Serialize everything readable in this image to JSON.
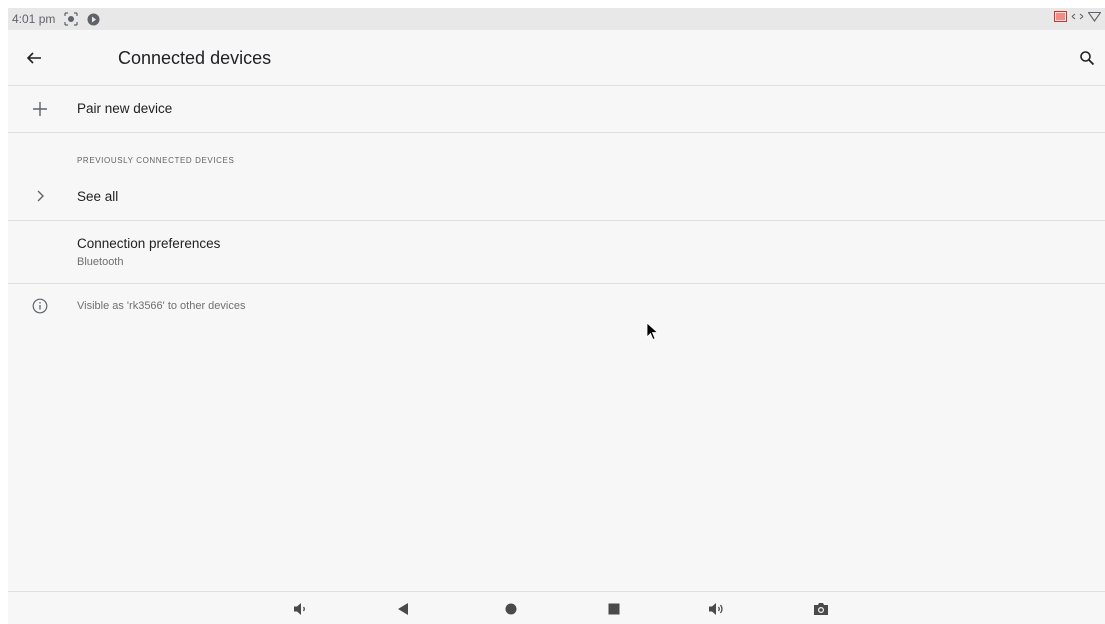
{
  "status_bar": {
    "time": "4:01 pm",
    "left_icons": [
      "screen-record-icon",
      "play-store-notification-icon"
    ],
    "right_icons": [
      "cast-icon",
      "data-transfer-icon",
      "wifi-icon"
    ]
  },
  "app_bar": {
    "title": "Connected devices",
    "back_icon": "arrow-left-icon",
    "search_icon": "search-icon"
  },
  "list": {
    "pair_new_device": {
      "label": "Pair new device",
      "icon": "plus-icon"
    },
    "previously_connected": {
      "section_title": "PREVIOUSLY CONNECTED DEVICES",
      "see_all": {
        "label": "See all",
        "icon": "chevron-right-icon"
      }
    },
    "connection_preferences": {
      "label": "Connection preferences",
      "summary": "Bluetooth"
    },
    "footer_info": {
      "text": "Visible as 'rk3566' to other devices",
      "icon": "info-icon"
    }
  },
  "nav_bar": {
    "buttons": [
      "volume-down-icon",
      "back-icon",
      "home-icon",
      "recents-icon",
      "volume-up-icon",
      "screenshot-icon"
    ]
  },
  "colors": {
    "background": "#f7f7f7",
    "status_bar": "#e8e8e8",
    "divider": "#e0e0e0",
    "primary_text": "#202124",
    "secondary_text": "#6f6f6f",
    "cast_icon_accent": "#d93025"
  }
}
